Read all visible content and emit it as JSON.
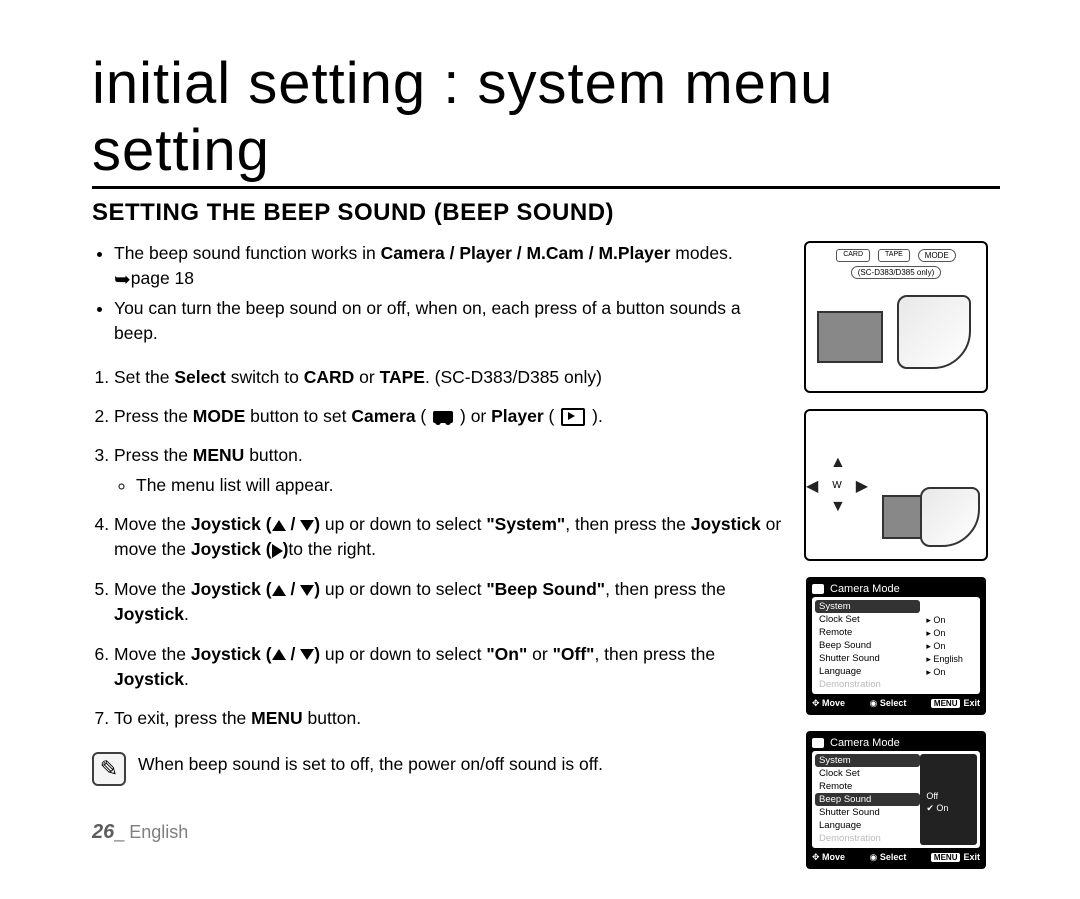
{
  "heading": "initial setting : system menu setting",
  "sub_heading": "SETTING THE BEEP SOUND (BEEP SOUND)",
  "bullets": {
    "b1_pre": "The beep sound function works in ",
    "b1_modes": "Camera / Player / M.Cam / M.Player",
    "b1_post": " modes.",
    "b1_ref": "page 18",
    "b2": "You can turn the beep sound on or off, when on, each press of a button sounds a beep."
  },
  "steps": {
    "s1_pre": "Set the ",
    "s1_b1": "Select",
    "s1_mid": " switch to ",
    "s1_b2": "CARD",
    "s1_or": " or ",
    "s1_b3": "TAPE",
    "s1_post": ". (SC-D383/D385 only)",
    "s2_pre": "Press the ",
    "s2_b1": "MODE",
    "s2_mid": " button to set ",
    "s2_b2": "Camera",
    "s2_or": " or ",
    "s2_b3": "Player",
    "s2_end": ".",
    "s3_pre": "Press the ",
    "s3_b1": "MENU",
    "s3_post": " button.",
    "s3_sub": "The menu list will appear.",
    "s4_pre": "Move the ",
    "s4_b1": "Joystick (",
    "s4_b1b": ")",
    "s4_mid": " up or down to select ",
    "s4_q": "\"System\"",
    "s4_mid2": ", then press the ",
    "s4_b2": "Joystick",
    "s4_mid3": " or move the ",
    "s4_b3": "Joystick (",
    "s4_b3b": ")",
    "s4_post": "to the right.",
    "s5_pre": "Move the ",
    "s5_b1": "Joystick (",
    "s5_b1b": ")",
    "s5_mid": " up or down to select ",
    "s5_q": "\"Beep Sound\"",
    "s5_mid2": ", then press the ",
    "s5_b2": "Joystick",
    "s5_post": ".",
    "s6_pre": "Move the ",
    "s6_b1": "Joystick (",
    "s6_b1b": ")",
    "s6_mid": " up or down to select ",
    "s6_q1": "\"On\"",
    "s6_or": " or ",
    "s6_q2": "\"Off\"",
    "s6_mid2": ", then press the ",
    "s6_b2": "Joystick",
    "s6_post": ".",
    "s7_pre": "To exit, press the ",
    "s7_b1": "MENU",
    "s7_post": " button."
  },
  "tip": "When beep sound is set to off, the power on/off sound is off.",
  "page_number": "26",
  "page_lang": "_ English",
  "fig1": {
    "card": "CARD",
    "tape": "TAPE",
    "mode": "MODE",
    "model": "(SC-D383/D385 only)"
  },
  "fig2": {
    "w": "W"
  },
  "menu1": {
    "title": "Camera Mode",
    "selected": "System",
    "items": [
      "Clock Set",
      "Remote",
      "Beep Sound",
      "Shutter Sound",
      "Language",
      "Demonstration"
    ],
    "opts": [
      "",
      "On",
      "On",
      "On",
      "English",
      "On"
    ],
    "move": "Move",
    "select": "Select",
    "menubtn": "MENU",
    "exit": "Exit"
  },
  "menu2": {
    "title": "Camera Mode",
    "selected_group": "System",
    "items": [
      "Clock Set",
      "Remote",
      "Beep Sound",
      "Shutter Sound",
      "Language",
      "Demonstration"
    ],
    "highlighted": "Beep Sound",
    "opts": [
      "Off",
      "On"
    ],
    "move": "Move",
    "select": "Select",
    "menubtn": "MENU",
    "exit": "Exit"
  }
}
